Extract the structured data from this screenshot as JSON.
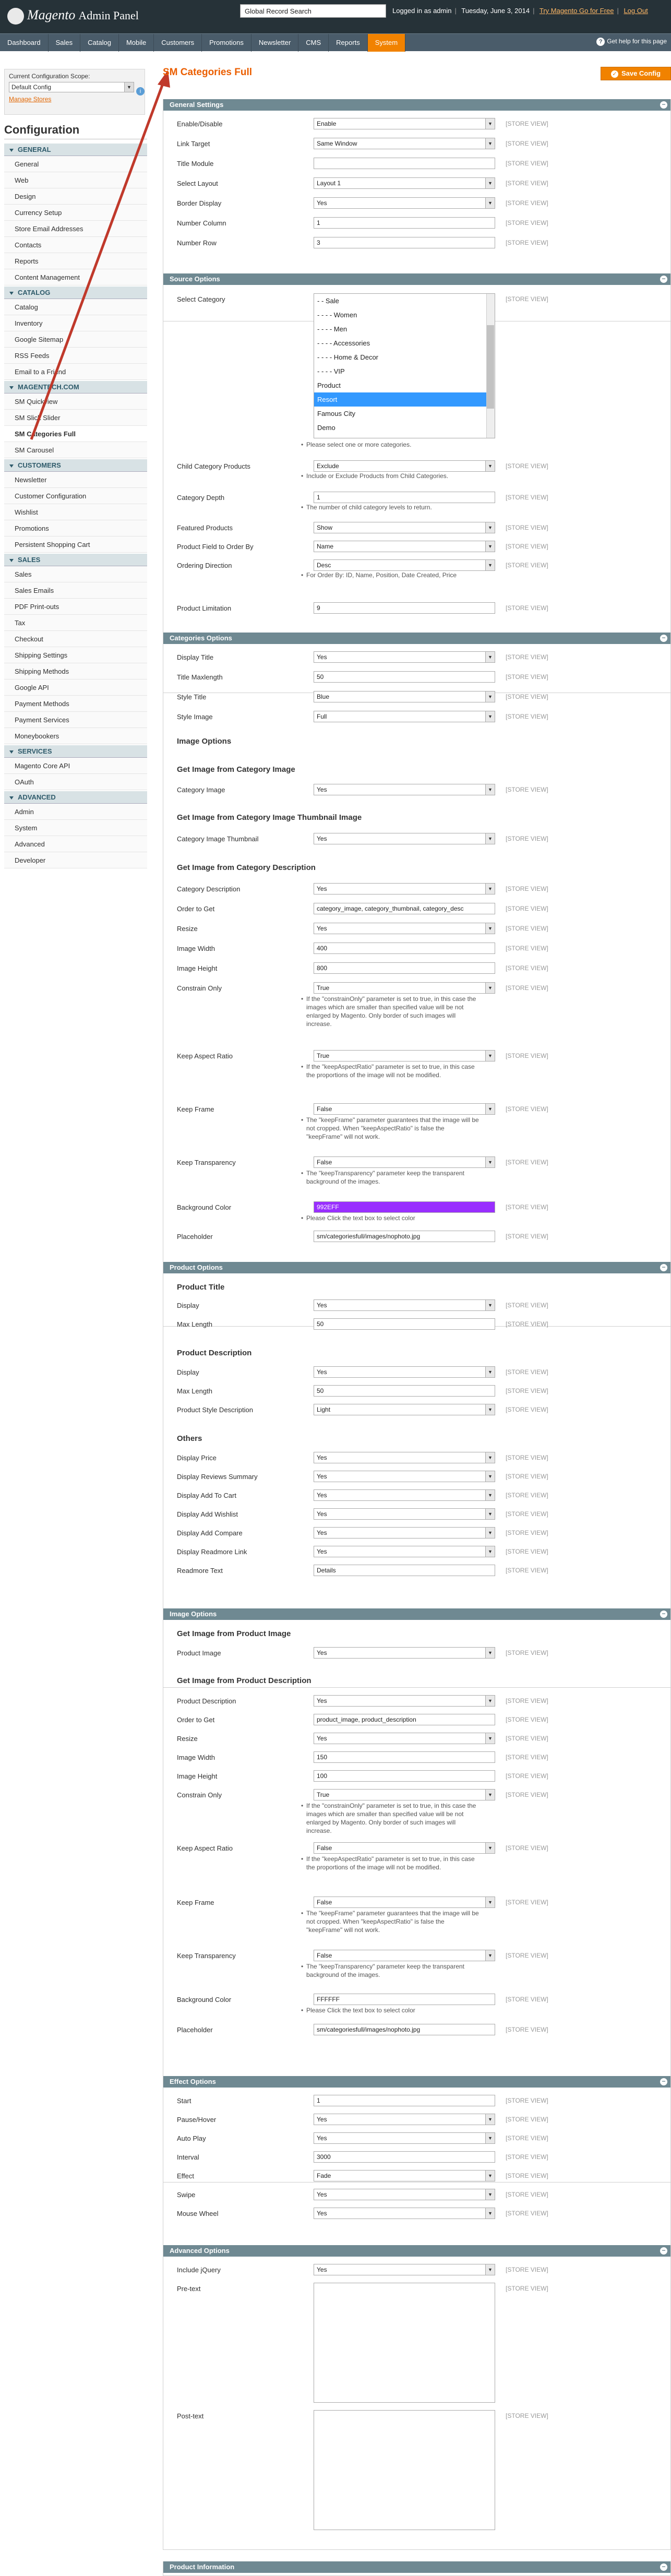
{
  "header": {
    "brand": "Magento",
    "subtitle": "Admin Panel",
    "search_value": "Global Record Search",
    "logged_in": "Logged in as admin",
    "date": "Tuesday, June 3, 2014",
    "try_link": "Try Magento Go for Free",
    "logout_link": "Log Out",
    "help_link": "Get help for this page"
  },
  "nav": {
    "items": [
      "Dashboard",
      "Sales",
      "Catalog",
      "Mobile",
      "Customers",
      "Promotions",
      "Newsletter",
      "CMS",
      "Reports",
      "System"
    ],
    "active_index": 9
  },
  "sidebar": {
    "scope_label": "Current Configuration Scope:",
    "scope_value": "Default Config",
    "manage_stores": "Manage Stores",
    "config_title": "Configuration",
    "groups": [
      {
        "title": "GENERAL",
        "items": [
          "General",
          "Web",
          "Design",
          "Currency Setup",
          "Store Email Addresses",
          "Contacts",
          "Reports",
          "Content Management"
        ]
      },
      {
        "title": "CATALOG",
        "items": [
          "Catalog",
          "Inventory",
          "Google Sitemap",
          "RSS Feeds",
          "Email to a Friend"
        ]
      },
      {
        "title": "MAGENTECH.COM",
        "items": [
          "SM Quickview",
          "SM Slick Slider",
          "SM Categories Full",
          "SM Carousel"
        ]
      },
      {
        "title": "CUSTOMERS",
        "items": [
          "Newsletter",
          "Customer Configuration",
          "Wishlist",
          "Promotions",
          "Persistent Shopping Cart"
        ]
      },
      {
        "title": "SALES",
        "items": [
          "Sales",
          "Sales Emails",
          "PDF Print-outs",
          "Tax",
          "Checkout",
          "Shipping Settings",
          "Shipping Methods",
          "Google API",
          "Payment Methods",
          "Payment Services",
          "Moneybookers"
        ]
      },
      {
        "title": "SERVICES",
        "items": [
          "Magento Core API",
          "OAuth"
        ]
      },
      {
        "title": "ADVANCED",
        "items": [
          "Admin",
          "System",
          "Advanced",
          "Developer"
        ]
      }
    ],
    "active_item": "SM Categories Full"
  },
  "page": {
    "title": "SM Categories Full",
    "save_label": "Save Config",
    "scope_tag": "[STORE VIEW]"
  },
  "general": {
    "title": "General Settings",
    "rows": [
      {
        "label": "Enable/Disable",
        "value": "Enable"
      },
      {
        "label": "Link Target",
        "value": "Same Window"
      },
      {
        "label": "Title Module",
        "value": ""
      },
      {
        "label": "Select Layout",
        "value": "Layout 1"
      },
      {
        "label": "Border Display",
        "value": "Yes"
      },
      {
        "label": "Number Column",
        "value": "1"
      },
      {
        "label": "Number Row",
        "value": "3"
      }
    ]
  },
  "source": {
    "title": "Source Options",
    "select_category_label": "Select Category",
    "categories": [
      "- - Sale",
      "- - - - Women",
      "- - - - Men",
      "- - - - Accessories",
      "- - - - Home & Decor",
      "- - - - VIP",
      "Product",
      "Resort",
      "Famous City",
      "Demo"
    ],
    "selected_category": "Resort",
    "category_note": "Please select one or more categories.",
    "child_label": "Child Category Products",
    "child_value": "Exclude",
    "child_note": "Include or Exclude Products from Child Categories.",
    "depth_label": "Category Depth",
    "depth_value": "1",
    "depth_note": "The number of child category levels to return.",
    "featured_label": "Featured Products",
    "featured_value": "Show",
    "order_field_label": "Product Field to Order By",
    "order_field_value": "Name",
    "ordering_label": "Ordering Direction",
    "ordering_value": "Desc",
    "ordering_note": "For Order By: ID, Name, Position, Date Created, Price",
    "limit_label": "Product Limitation",
    "limit_value": "9"
  },
  "categories_opts": {
    "title": "Categories Options",
    "display_title_label": "Display Title",
    "display_title_value": "Yes",
    "title_maxlen_label": "Title Maxlength",
    "title_maxlen_value": "50",
    "style_title_label": "Style Title",
    "style_title_value": "Blue",
    "style_image_label": "Style Image",
    "style_image_value": "Full",
    "image_options_h": "Image Options",
    "get_img_cat_h": "Get Image from Category Image",
    "cat_image_label": "Category Image",
    "cat_image_value": "Yes",
    "get_img_thumb_h": "Get Image from Category Image Thumbnail Image",
    "cat_thumb_label": "Category Image Thumbnail",
    "cat_thumb_value": "Yes",
    "get_img_desc_h": "Get Image from Category Description",
    "cat_desc_label": "Category Description",
    "cat_desc_value": "Yes",
    "order_get_label": "Order to Get",
    "order_get_value": "category_image, category_thumbnail, category_desc",
    "resize_label": "Resize",
    "resize_value": "Yes",
    "img_width_label": "Image Width",
    "img_width_value": "400",
    "img_height_label": "Image Height",
    "img_height_value": "800",
    "constrain_label": "Constrain Only",
    "constrain_value": "True",
    "constrain_note": "If the \"constrainOnly\" parameter is set to true, in this case the images which are smaller than specified value will be not enlarged by Magento. Only border of such images will increase.",
    "aspect_label": "Keep Aspect Ratio",
    "aspect_value": "True",
    "aspect_note": "If the \"keepAspectRatio\" parameter is set to true, in this case the proportions of the image will not be modified.",
    "frame_label": "Keep Frame",
    "frame_value": "False",
    "frame_note": "The \"keepFrame\" parameter guarantees that the image will be not cropped. When \"keepAspectRatio\" is false the \"keepFrame\" will not work.",
    "transp_label": "Keep Transparency",
    "transp_value": "False",
    "transp_note": "The \"keepTransparency\" parameter keep the transparent background of the images.",
    "bg_label": "Background Color",
    "bg_value": "992EFF",
    "bg_color": "#992eff",
    "bg_note": "Please Click the text box to select color",
    "placeholder_label": "Placeholder",
    "placeholder_value": "sm/categoriesfull/images/nophoto.jpg"
  },
  "product_opts": {
    "title": "Product Options",
    "ptitle_h": "Product Title",
    "display_label": "Display",
    "display_value": "Yes",
    "maxlen_label": "Max Length",
    "maxlen_value": "50",
    "pdesc_h": "Product Description",
    "d_display_label": "Display",
    "d_display_value": "Yes",
    "d_maxlen_label": "Max Length",
    "d_maxlen_value": "50",
    "style_desc_label": "Product Style Description",
    "style_desc_value": "Light",
    "others_h": "Others",
    "price_label": "Display Price",
    "price_value": "Yes",
    "reviews_label": "Display Reviews Summary",
    "reviews_value": "Yes",
    "cart_label": "Display Add To Cart",
    "cart_value": "Yes",
    "wishlist_label": "Display Add Wishlist",
    "wishlist_value": "Yes",
    "compare_label": "Display Add Compare",
    "compare_value": "Yes",
    "readmore_label": "Display Readmore Link",
    "readmore_value": "Yes",
    "readmore_text_label": "Readmore Text",
    "readmore_text_value": "Details"
  },
  "image_opts": {
    "title": "Image Options",
    "get_prod_img_h": "Get Image from Product Image",
    "prod_image_label": "Product Image",
    "prod_image_value": "Yes",
    "get_prod_desc_h": "Get Image from Product Description",
    "prod_desc_label": "Product Description",
    "prod_desc_value": "Yes",
    "order_get_label": "Order to Get",
    "order_get_value": "product_image, product_description",
    "resize_label": "Resize",
    "resize_value": "Yes",
    "img_width_label": "Image Width",
    "img_width_value": "150",
    "img_height_label": "Image Height",
    "img_height_value": "100",
    "constrain_label": "Constrain Only",
    "constrain_value": "True",
    "constrain_note": "If the \"constrainOnly\" parameter is set to true, in this case the images which are smaller than specified value will be not enlarged by Magento. Only border of such images will increase.",
    "aspect_label": "Keep Aspect Ratio",
    "aspect_value": "False",
    "aspect_note": "If the \"keepAspectRatio\" parameter is set to true, in this case the proportions of the image will not be modified.",
    "frame_label": "Keep Frame",
    "frame_value": "False",
    "frame_note": "The \"keepFrame\" parameter guarantees that the image will be not cropped. When \"keepAspectRatio\" is false the \"keepFrame\" will not work.",
    "transp_label": "Keep Transparency",
    "transp_value": "False",
    "transp_note": "The \"keepTransparency\" parameter keep the transparent background of the images.",
    "bg_label": "Background Color",
    "bg_value": "FFFFFF",
    "bg_note": "Please Click the text box to select color",
    "placeholder_label": "Placeholder",
    "placeholder_value": "sm/categoriesfull/images/nophoto.jpg"
  },
  "effect_opts": {
    "title": "Effect Options",
    "start_label": "Start",
    "start_value": "1",
    "pause_label": "Pause/Hover",
    "pause_value": "Yes",
    "autoplay_label": "Auto Play",
    "autoplay_value": "Yes",
    "interval_label": "Interval",
    "interval_value": "3000",
    "effect_label": "Effect",
    "effect_value": "Fade",
    "swipe_label": "Swipe",
    "swipe_value": "Yes",
    "wheel_label": "Mouse Wheel",
    "wheel_value": "Yes"
  },
  "advanced_opts": {
    "title": "Advanced Options",
    "jquery_label": "Include jQuery",
    "jquery_value": "Yes",
    "pretext_label": "Pre-text",
    "posttext_label": "Post-text"
  },
  "product_info": {
    "title": "Product Information"
  },
  "colors": {
    "accent": "#f18200",
    "section_header": "#6f8992",
    "title_orange": "#eb5e00",
    "arrow": "#c0392b"
  }
}
